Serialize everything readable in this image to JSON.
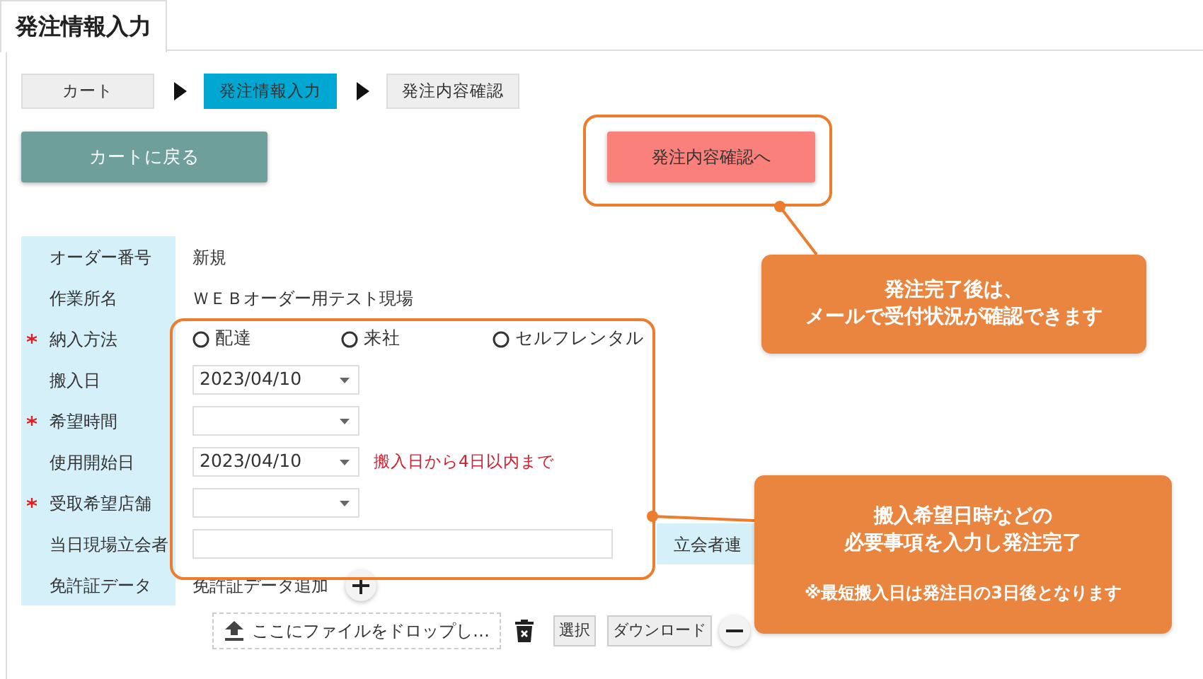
{
  "tab": {
    "label": "発注情報入力",
    "selected": true
  },
  "steps": [
    {
      "label": "カート",
      "selected": false
    },
    {
      "label": "発注情報入力",
      "selected": true
    },
    {
      "label": "発注内容確認",
      "selected": false
    }
  ],
  "back_button": "カートに戻る",
  "confirm_button": "発注内容確認へ",
  "form": {
    "rows": [
      {
        "kind": "text",
        "label": "オーダー番号",
        "required": false,
        "value": "新規"
      },
      {
        "kind": "text",
        "label": "作業所名",
        "required": false,
        "value": "ＷＥＢオーダー用テスト現場"
      },
      {
        "kind": "radio",
        "label": "納入方法",
        "required": true,
        "options": [
          {
            "label": "配達",
            "selected": false
          },
          {
            "label": "来社",
            "selected": false
          },
          {
            "label": "セルフレンタル",
            "selected": false
          }
        ]
      },
      {
        "kind": "select",
        "label": "搬入日",
        "required": false,
        "value": "2023/04/10"
      },
      {
        "kind": "select",
        "label": "希望時間",
        "required": true
      },
      {
        "kind": "select",
        "label": "使用開始日",
        "required": false,
        "value": "2023/04/10",
        "note": "搬入日から4日以内まで"
      },
      {
        "kind": "select",
        "label": "受取希望店舗",
        "required": true
      },
      {
        "kind": "input",
        "label": "当日現場立会者",
        "required": false,
        "side_label": "立会者連"
      },
      {
        "kind": "file",
        "label": "免許証データ",
        "required": false,
        "add_text": "免許証データ追加",
        "drop_text": "ここにファイルをドロップし…",
        "select_button": "選択",
        "download_button": "ダウンロード"
      }
    ]
  },
  "callouts": [
    {
      "lines": [
        "発注完了後は、",
        "メールで受付状況が確認できます"
      ]
    },
    {
      "lines": [
        "搬入希望日時などの",
        "必要事項を入力し発注完了"
      ],
      "note": "※最短搬入日は発注日の3日後となります"
    }
  ]
}
